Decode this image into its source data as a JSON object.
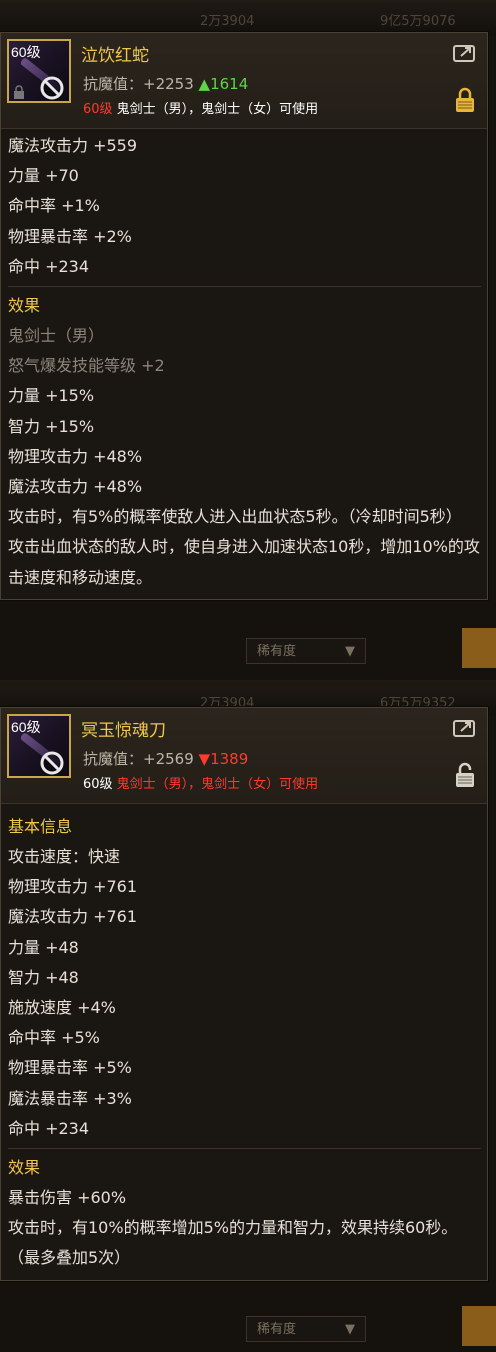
{
  "tooltip1": {
    "level_badge": "60级",
    "name": "泣饮红蛇",
    "resist_label": "抗魔值：",
    "resist_value": "+2253",
    "resist_diff": "▲1614",
    "req_level": "60级",
    "req_text": " 鬼剑士（男），鬼剑士（女）可使用",
    "stats": [
      "魔法攻击力 +559",
      "力量 +70",
      "命中率 +1%",
      "物理暴击率 +2%",
      "命中 +234"
    ],
    "effect_header": "效果",
    "effects_gray": [
      "鬼剑士（男）",
      "怒气爆发技能等级 +2"
    ],
    "effects": [
      "力量 +15%",
      "智力 +15%",
      "物理攻击力 +48%",
      "魔法攻击力 +48%"
    ],
    "effect_long_1": "攻击时，有5%的概率使敌人进入出血状态5秒。（冷却时间5秒）",
    "effect_long_2": "攻击出血状态的敌人时，使自身进入加速状态10秒，增加10%的攻击速度和移动速度。",
    "icons": [
      "share-icon",
      "lock-icon",
      "forbidden-icon"
    ],
    "lock_color": "#e8b43a"
  },
  "tooltip2": {
    "level_badge": "60级",
    "name": "冥玉惊魂刀",
    "resist_label": "抗魔值：",
    "resist_value": "+2569",
    "resist_diff": "▼1389",
    "req_level": "60级",
    "req_text": " 鬼剑士（男），鬼剑士（女）可使用",
    "basic_header": "基本信息",
    "stats": [
      "攻击速度：快速",
      "物理攻击力 +761",
      "魔法攻击力 +761",
      "力量 +48",
      "智力 +48",
      "施放速度 +4%",
      "命中率 +5%",
      "物理暴击率 +5%",
      "魔法暴击率 +3%",
      "命中 +234"
    ],
    "effect_header": "效果",
    "effects": [
      "暴击伤害 +60%"
    ],
    "effect_long_1": "攻击时，有10%的概率增加5%的力量和智力，效果持续60秒。（最多叠加5次）",
    "icons": [
      "share-icon",
      "unlock-icon",
      "forbidden-icon"
    ],
    "lock_color": "#d8d2c6"
  },
  "background": {
    "rarity_dropdown": "稀有度",
    "bg_numbers_1": [
      "2万3904",
      "9亿5万9076"
    ],
    "bg_numbers_2": [
      "2万3904",
      "6万5万9352"
    ]
  },
  "colors": {
    "gold": "#f0c84a",
    "up": "#5fd34a",
    "down": "#ff3a2e"
  }
}
